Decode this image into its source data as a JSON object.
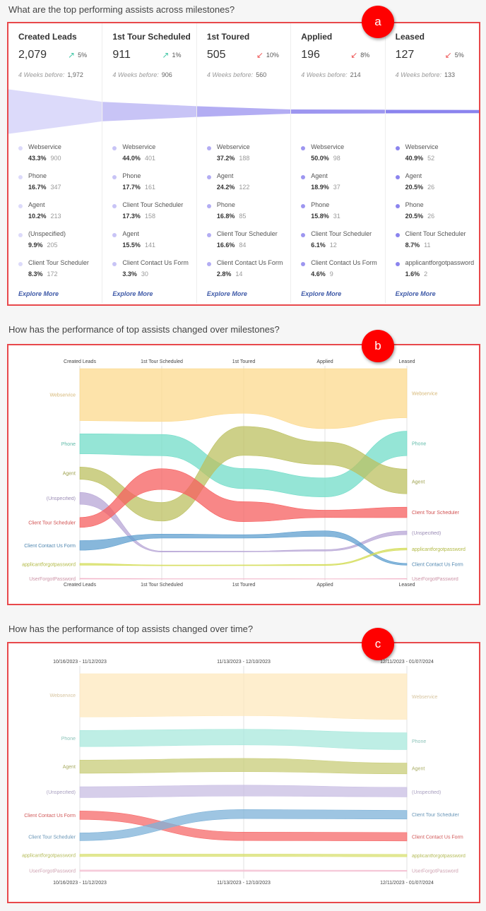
{
  "sections": [
    {
      "question": "What are the top performing assists across milestones?",
      "badge": "a"
    },
    {
      "question": "How has the performance of top assists changed over milestones?",
      "badge": "b"
    },
    {
      "question": "How has the performance of top assists changed over time?",
      "badge": "c"
    }
  ],
  "funnel_colors": [
    "#dcdafa",
    "#c8c4f6",
    "#b3adf3",
    "#9d96f0",
    "#8b84ee"
  ],
  "milestones": [
    {
      "title": "Created Leads",
      "value": "2,079",
      "count": 2079,
      "change": "5%",
      "direction": "up",
      "before_label": "4 Weeks before:",
      "before": "1,972",
      "items": [
        {
          "name": "Webservice",
          "pct": "43.3%",
          "count": "900"
        },
        {
          "name": "Phone",
          "pct": "16.7%",
          "count": "347"
        },
        {
          "name": "Agent",
          "pct": "10.2%",
          "count": "213"
        },
        {
          "name": "(Unspecified)",
          "pct": "9.9%",
          "count": "205"
        },
        {
          "name": "Client Tour Scheduler",
          "pct": "8.3%",
          "count": "172"
        }
      ],
      "explore": "Explore More"
    },
    {
      "title": "1st Tour Scheduled",
      "value": "911",
      "count": 911,
      "change": "1%",
      "direction": "up",
      "before_label": "4 Weeks before:",
      "before": "906",
      "items": [
        {
          "name": "Webservice",
          "pct": "44.0%",
          "count": "401"
        },
        {
          "name": "Phone",
          "pct": "17.7%",
          "count": "161"
        },
        {
          "name": "Client Tour Scheduler",
          "pct": "17.3%",
          "count": "158"
        },
        {
          "name": "Agent",
          "pct": "15.5%",
          "count": "141"
        },
        {
          "name": "Client Contact Us Form",
          "pct": "3.3%",
          "count": "30"
        }
      ],
      "explore": "Explore More"
    },
    {
      "title": "1st Toured",
      "value": "505",
      "count": 505,
      "change": "10%",
      "direction": "down",
      "before_label": "4 Weeks before:",
      "before": "560",
      "items": [
        {
          "name": "Webservice",
          "pct": "37.2%",
          "count": "188"
        },
        {
          "name": "Agent",
          "pct": "24.2%",
          "count": "122"
        },
        {
          "name": "Phone",
          "pct": "16.8%",
          "count": "85"
        },
        {
          "name": "Client Tour Scheduler",
          "pct": "16.6%",
          "count": "84"
        },
        {
          "name": "Client Contact Us Form",
          "pct": "2.8%",
          "count": "14"
        }
      ],
      "explore": "Explore More"
    },
    {
      "title": "Applied",
      "value": "196",
      "count": 196,
      "change": "8%",
      "direction": "down",
      "before_label": "4 Weeks before:",
      "before": "214",
      "items": [
        {
          "name": "Webservice",
          "pct": "50.0%",
          "count": "98"
        },
        {
          "name": "Agent",
          "pct": "18.9%",
          "count": "37"
        },
        {
          "name": "Phone",
          "pct": "15.8%",
          "count": "31"
        },
        {
          "name": "Client Tour Scheduler",
          "pct": "6.1%",
          "count": "12"
        },
        {
          "name": "Client Contact Us Form",
          "pct": "4.6%",
          "count": "9"
        }
      ],
      "explore": "Explore More"
    },
    {
      "title": "Leased",
      "value": "127",
      "count": 127,
      "change": "5%",
      "direction": "down",
      "before_label": "4 Weeks before:",
      "before": "133",
      "items": [
        {
          "name": "Webservice",
          "pct": "40.9%",
          "count": "52"
        },
        {
          "name": "Agent",
          "pct": "20.5%",
          "count": "26"
        },
        {
          "name": "Phone",
          "pct": "20.5%",
          "count": "26"
        },
        {
          "name": "Client Tour Scheduler",
          "pct": "8.7%",
          "count": "11"
        },
        {
          "name": "applicantforgotpassword",
          "pct": "1.6%",
          "count": "2"
        }
      ],
      "explore": "Explore More"
    }
  ],
  "chart_data": [
    {
      "type": "area",
      "subtype": "bump",
      "columns": [
        "Created Leads",
        "1st Tour Scheduled",
        "1st Toured",
        "Applied",
        "Leased"
      ],
      "grid": true,
      "series": [
        {
          "name": "Webservice",
          "color": "#fcd98e",
          "values": [
            43.3,
            44.0,
            37.2,
            50.0,
            40.9
          ]
        },
        {
          "name": "Phone",
          "color": "#72dcc8",
          "values": [
            16.7,
            17.7,
            16.8,
            15.8,
            20.5
          ]
        },
        {
          "name": "Agent",
          "color": "#bcc060",
          "values": [
            10.2,
            15.5,
            24.2,
            18.9,
            20.5
          ]
        },
        {
          "name": "(Unspecified)",
          "color": "#b7a6d6",
          "values": [
            9.9,
            0.8,
            0.6,
            1.2,
            3.0
          ]
        },
        {
          "name": "Client Tour Scheduler",
          "color": "#f65f5f",
          "values": [
            8.3,
            17.3,
            16.6,
            6.1,
            8.7
          ]
        },
        {
          "name": "Client Contact Us Form",
          "color": "#5f9fcf",
          "values": [
            8.0,
            3.3,
            2.8,
            4.6,
            1.5
          ]
        },
        {
          "name": "applicantforgotpassword",
          "color": "#d3dc55",
          "values": [
            1.5,
            0.6,
            0.6,
            1.0,
            1.6
          ]
        },
        {
          "name": "UserForgotPassword",
          "color": "#f1afc5",
          "values": [
            0.6,
            0.3,
            0.3,
            0.2,
            0.4
          ]
        }
      ]
    },
    {
      "type": "area",
      "subtype": "bump",
      "columns": [
        "10/16/2023 - 11/12/2023",
        "11/13/2023 - 12/10/2023",
        "12/11/2023 - 01/07/2024"
      ],
      "grid": true,
      "series": [
        {
          "name": "Webservice",
          "color": "#fde8bd",
          "values": [
            36,
            35,
            38
          ]
        },
        {
          "name": "Phone",
          "color": "#a8e8dc",
          "values": [
            13.5,
            13,
            14
          ]
        },
        {
          "name": "Agent",
          "color": "#c8cc78",
          "values": [
            11,
            11,
            9
          ]
        },
        {
          "name": "(Unspecified)",
          "color": "#c8bde3",
          "values": [
            9,
            9,
            8
          ]
        },
        {
          "name": "Client Contact Us Form",
          "color": "#f66a6a",
          "values": [
            7,
            7,
            7
          ]
        },
        {
          "name": "Client Tour Scheduler",
          "color": "#7eb2d8",
          "values": [
            6.5,
            7.5,
            7.2
          ]
        },
        {
          "name": "applicantforgotpassword",
          "color": "#d8e070",
          "values": [
            2,
            2,
            2
          ]
        },
        {
          "name": "UserForgotPassword",
          "color": "#f4bfd1",
          "values": [
            1.2,
            1.2,
            1
          ]
        }
      ]
    }
  ]
}
